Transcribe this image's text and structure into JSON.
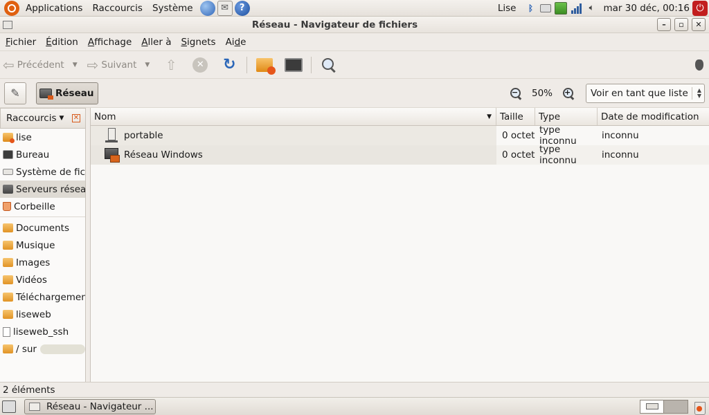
{
  "top_panel": {
    "menus": [
      "Applications",
      "Raccourcis",
      "Système"
    ],
    "user": "Lise",
    "clock": "mar 30 déc, 00:16",
    "icons": [
      "ubuntu-logo",
      "web-browser-icon",
      "mail-icon",
      "help-icon",
      "bluetooth-icon",
      "keyboard-icon",
      "battery-icon",
      "network-signal-icon",
      "volume-icon",
      "power-icon"
    ]
  },
  "window": {
    "title": "Réseau - Navigateur de fichiers"
  },
  "menubar": {
    "items": [
      {
        "pre": "",
        "key": "F",
        "post": "ichier"
      },
      {
        "pre": "",
        "key": "É",
        "post": "dition"
      },
      {
        "pre": "",
        "key": "A",
        "post": "ffichage"
      },
      {
        "pre": "",
        "key": "A",
        "post": "ller à"
      },
      {
        "pre": "",
        "key": "S",
        "post": "ignets"
      },
      {
        "pre": "Ai",
        "key": "d",
        "post": "e"
      }
    ]
  },
  "toolbar": {
    "back_label": "Précédent",
    "forward_label": "Suivant"
  },
  "location": {
    "crumb": "Réseau",
    "zoom": "50%",
    "view_mode": "Voir en tant que liste"
  },
  "sidebar": {
    "title": "Raccourcis",
    "places": [
      {
        "label": "lise",
        "icon": "home"
      },
      {
        "label": "Bureau",
        "icon": "desktop"
      },
      {
        "label": "Système de fichiers",
        "icon": "disk"
      },
      {
        "label": "Serveurs réseau",
        "icon": "netsrv",
        "selected": true
      },
      {
        "label": "Corbeille",
        "icon": "trash"
      }
    ],
    "bookmarks": [
      {
        "label": "Documents",
        "icon": "folder"
      },
      {
        "label": "Musique",
        "icon": "folder"
      },
      {
        "label": "Images",
        "icon": "folder"
      },
      {
        "label": "Vidéos",
        "icon": "folder"
      },
      {
        "label": "Téléchargements",
        "icon": "folder"
      },
      {
        "label": "liseweb",
        "icon": "folder"
      },
      {
        "label": "liseweb_ssh",
        "icon": "file"
      },
      {
        "label": "/ sur",
        "icon": "folder",
        "mount": true
      }
    ]
  },
  "file_list": {
    "columns": [
      "Nom",
      "Taille",
      "Type",
      "Date de modification"
    ],
    "rows": [
      {
        "name": "portable",
        "size": "0 octet",
        "type": "type inconnu",
        "date": "inconnu",
        "icon": "computer-icon"
      },
      {
        "name": "Réseau Windows",
        "size": "0 octet",
        "type": "type inconnu",
        "date": "inconnu",
        "icon": "windows-network-icon"
      }
    ]
  },
  "status": {
    "text": "2 éléments"
  },
  "bottom_panel": {
    "task": "Réseau - Navigateur ..."
  }
}
